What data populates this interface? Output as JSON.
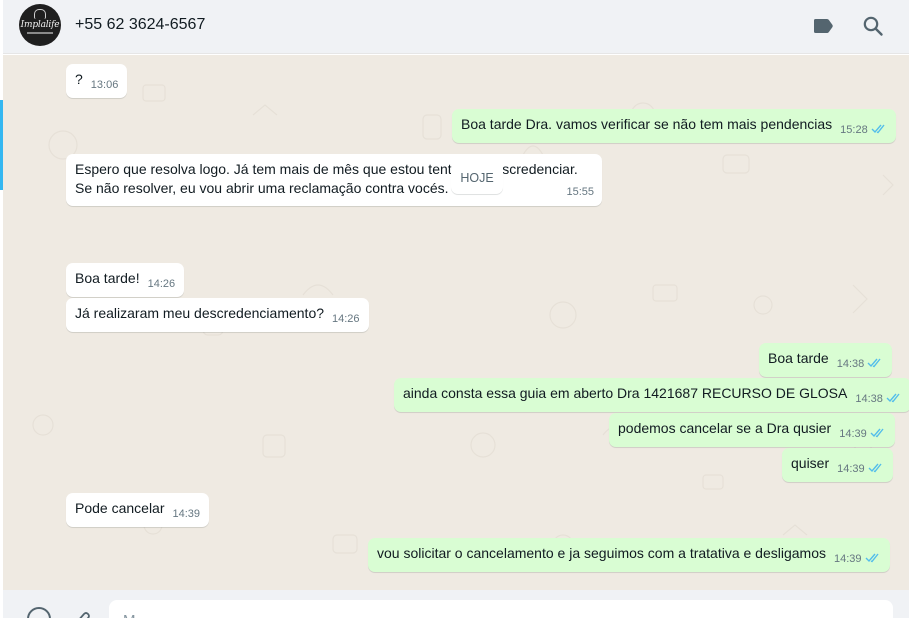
{
  "header": {
    "avatar_text": "Implalife",
    "contact_name": "+55 62 3624-6567",
    "icons": [
      "label-icon",
      "search-icon"
    ]
  },
  "messages": [
    {
      "dir": "in",
      "text": "?",
      "time": "13:06"
    },
    {
      "dir": "out",
      "text": "Boa tarde Dra. vamos verificar se não tem mais pendencias",
      "time": "15:28"
    },
    {
      "dir": "in",
      "lines": [
        "Espero que resolva logo. Já tem mais de mês que estou tentando descredenciar.",
        "Se não resolver, eu vou abrir uma reclamação contra vocés."
      ],
      "time": "15:55"
    },
    {
      "dir": "in",
      "text": "Boa tarde!",
      "time": "14:26"
    },
    {
      "dir": "in",
      "text": "Já realizaram meu descredenciamento?",
      "time": "14:26"
    },
    {
      "dir": "out",
      "text": "Boa tarde",
      "time": "14:38"
    },
    {
      "dir": "out",
      "text": "ainda consta essa guia em aberto Dra 1421687 RECURSO DE GLOSA",
      "time": "14:38"
    },
    {
      "dir": "out",
      "text": "podemos cancelar se a Dra qusier",
      "time": "14:39"
    },
    {
      "dir": "out",
      "text": "quiser",
      "time": "14:39"
    },
    {
      "dir": "in",
      "text": "Pode cancelar",
      "time": "14:39"
    },
    {
      "dir": "out",
      "text": "vou solicitar o cancelamento e ja seguimos com a tratativa e desligamos",
      "time": "14:39"
    }
  ],
  "date_divider": "HOJE",
  "footer": {
    "input_placeholder": "M"
  },
  "colors": {
    "chat_bg": "#efeae2",
    "outgoing_bubble": "#d9fdd3",
    "incoming_bubble": "#ffffff",
    "read_ticks": "#53bdeb",
    "header_bg": "#f0f2f5"
  }
}
